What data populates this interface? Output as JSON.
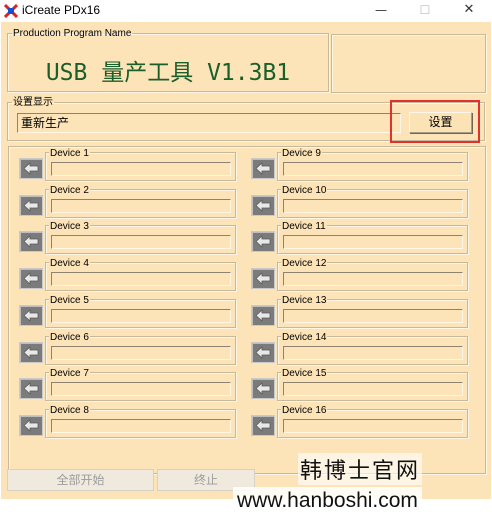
{
  "window": {
    "title": "iCreate PDx16",
    "minimize": "—",
    "maximize": "☐",
    "close": "✕"
  },
  "production": {
    "legend": "Production Program Name",
    "title": "USB 量产工具 V1.3B1"
  },
  "settings": {
    "legend": "设置显示",
    "value": "重新生产",
    "button_label": "设置"
  },
  "devices": [
    {
      "label": "Device 1"
    },
    {
      "label": "Device 2"
    },
    {
      "label": "Device 3"
    },
    {
      "label": "Device 4"
    },
    {
      "label": "Device 5"
    },
    {
      "label": "Device 6"
    },
    {
      "label": "Device 7"
    },
    {
      "label": "Device 8"
    },
    {
      "label": "Device 9"
    },
    {
      "label": "Device 10"
    },
    {
      "label": "Device 11"
    },
    {
      "label": "Device 12"
    },
    {
      "label": "Device 13"
    },
    {
      "label": "Device 14"
    },
    {
      "label": "Device 15"
    },
    {
      "label": "Device 16"
    }
  ],
  "footer": {
    "start_all": "全部开始",
    "stop": "终止"
  },
  "watermark": {
    "cn": "韩博士官网",
    "url": "www.hanboshi.com"
  },
  "colors": {
    "background": "#fde4b8",
    "title_green": "#1a5e2a",
    "highlight_red": "#e0312b"
  },
  "icons": {
    "app": "app-icon",
    "device_arrow": "arrow-left-icon"
  }
}
